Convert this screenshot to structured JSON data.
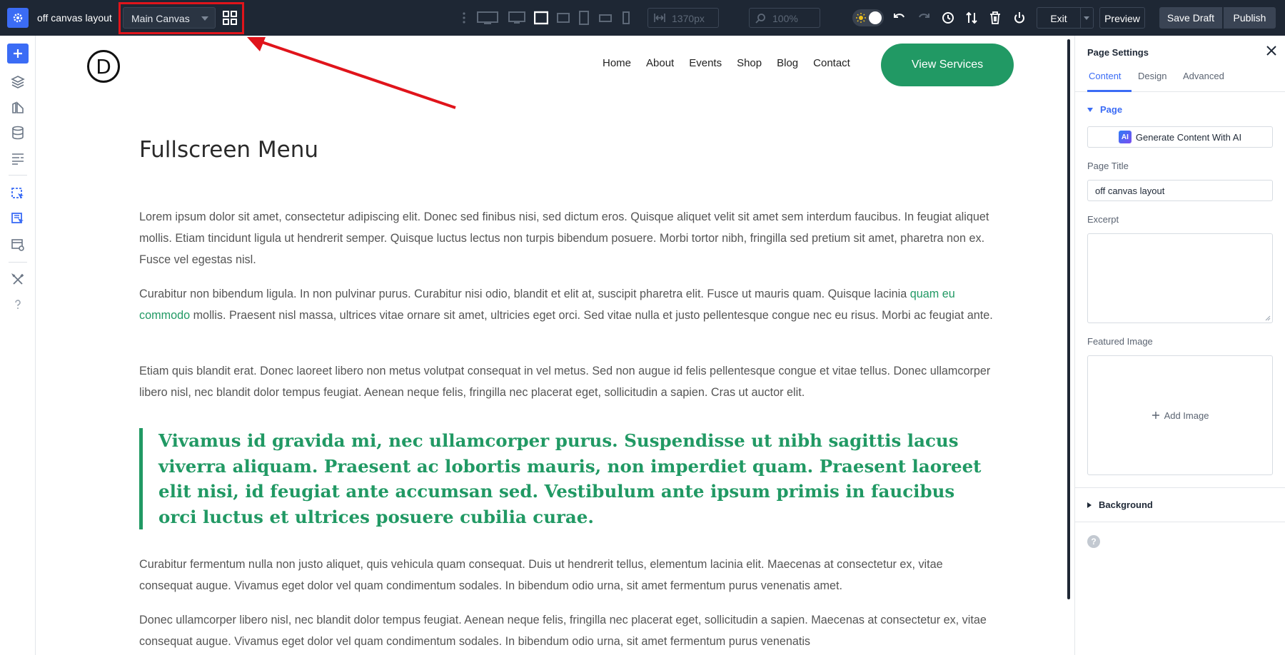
{
  "topbar": {
    "site_title": "off canvas layout",
    "canvas_select": "Main Canvas",
    "width_value": "1370px",
    "zoom_value": "100%",
    "exit_label": "Exit",
    "preview_label": "Preview",
    "save_label": "Save Draft",
    "publish_label": "Publish"
  },
  "site": {
    "logo_letter": "D",
    "nav": [
      "Home",
      "About",
      "Events",
      "Shop",
      "Blog",
      "Contact"
    ],
    "cta_label": "View Services"
  },
  "content": {
    "heading": "Fullscreen Menu",
    "p1": "Lorem ipsum dolor sit amet, consectetur adipiscing elit. Donec sed finibus nisi, sed dictum eros. Quisque aliquet velit sit amet sem interdum faucibus. In feugiat aliquet mollis. Etiam tincidunt ligula ut hendrerit semper. Quisque luctus lectus non turpis bibendum posuere. Morbi tortor nibh, fringilla sed pretium sit amet, pharetra non ex. Fusce vel egestas nisl.",
    "p2_before": "Curabitur non bibendum ligula. In non pulvinar purus. Curabitur nisi odio, blandit et elit at, suscipit pharetra elit. Fusce ut mauris quam. Quisque lacinia ",
    "p2_link": "quam eu commodo",
    "p2_after": " mollis. Praesent nisl massa, ultrices vitae ornare sit amet, ultricies eget orci. Sed vitae nulla et justo pellentesque congue nec eu risus. Morbi ac feugiat ante.",
    "p3": "Etiam quis blandit erat. Donec laoreet libero non metus volutpat consequat in vel metus. Sed non augue id felis pellentesque congue et vitae tellus. Donec ullamcorper libero nisl, nec blandit dolor tempus feugiat. Aenean neque felis, fringilla nec placerat eget, sollicitudin a sapien. Cras ut auctor elit.",
    "quote": "Vivamus id gravida mi, nec ullamcorper purus. Suspendisse ut nibh sagittis lacus viverra aliquam. Praesent ac lobortis mauris, non imperdiet quam. Praesent laoreet elit nisi, id feugiat ante accumsan sed. Vestibulum ante ipsum primis in faucibus orci luctus et ultrices posuere cubilia curae.",
    "p4": "Curabitur fermentum nulla non justo aliquet, quis vehicula quam consequat. Duis ut hendrerit tellus, elementum lacinia elit. Maecenas at consectetur ex, vitae consequat augue. Vivamus eget dolor vel quam condimentum sodales. In bibendum odio urna, sit amet fermentum purus venenatis amet.",
    "p5": "Donec ullamcorper libero nisl, nec blandit dolor tempus feugiat. Aenean neque felis, fringilla nec placerat eget, sollicitudin a sapien. Maecenas at consectetur ex, vitae consequat augue. Vivamus eget dolor vel quam condimentum sodales. In bibendum odio urna, sit amet fermentum purus venenatis"
  },
  "panel": {
    "title": "Page Settings",
    "tabs": [
      "Content",
      "Design",
      "Advanced"
    ],
    "section_page": "Page",
    "ai_button": "Generate Content With AI",
    "ai_badge": "AI",
    "page_title_label": "Page Title",
    "page_title_value": "off canvas layout",
    "excerpt_label": "Excerpt",
    "featured_image_label": "Featured Image",
    "add_image_label": "Add Image",
    "section_background": "Background",
    "help": "?"
  },
  "colors": {
    "accent": "#3b6cf5",
    "brand_green": "#219964",
    "topbar_bg": "#1e2734",
    "highlight_red": "#e0141b"
  }
}
